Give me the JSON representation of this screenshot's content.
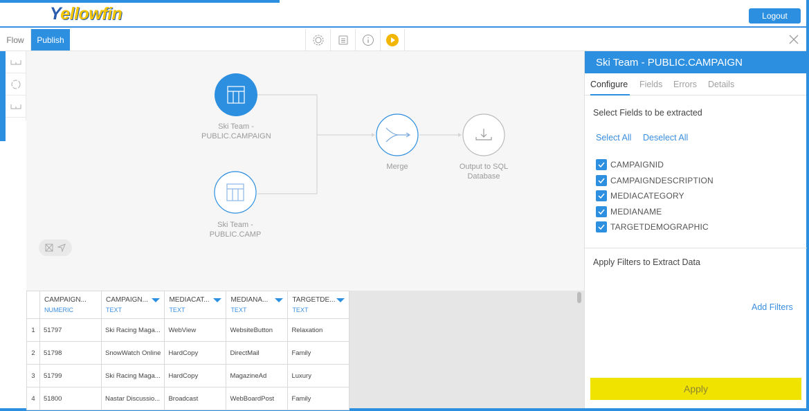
{
  "app": {
    "logo_prefix": "Y",
    "logo_rest": "ellowfin"
  },
  "header": {
    "logout_label": "Logout"
  },
  "toolbar": {
    "tabs": [
      {
        "label": "Flow"
      },
      {
        "label": "Publish"
      }
    ],
    "icons": [
      "settings-icon",
      "notes-icon",
      "info-icon",
      "play-icon"
    ]
  },
  "flow": {
    "nodes": [
      {
        "label_line1": "Ski Team -",
        "label_line2": "PUBLIC.CAMPAIGN"
      },
      {
        "label_line1": "Ski Team -",
        "label_line2": "PUBLIC.CAMP"
      },
      {
        "label_line1": "Merge",
        "label_line2": ""
      },
      {
        "label_line1": "Output to SQL",
        "label_line2": "Database"
      }
    ]
  },
  "grid": {
    "columns": [
      {
        "name": "CAMPAIGN...",
        "type": "NUMERIC"
      },
      {
        "name": "CAMPAIGN...",
        "type": "TEXT"
      },
      {
        "name": "MEDIACAT...",
        "type": "TEXT"
      },
      {
        "name": "MEDIANA...",
        "type": "TEXT"
      },
      {
        "name": "TARGETDE...",
        "type": "TEXT"
      }
    ],
    "rows": [
      {
        "num": "1",
        "cells": [
          "51797",
          "Ski Racing Maga...",
          "WebView",
          "WebsiteButton",
          "Relaxation"
        ]
      },
      {
        "num": "2",
        "cells": [
          "51798",
          "SnowWatch Online",
          "HardCopy",
          "DirectMail",
          "Family"
        ]
      },
      {
        "num": "3",
        "cells": [
          "51799",
          "Ski Racing Maga...",
          "HardCopy",
          "MagazineAd",
          "Luxury"
        ]
      },
      {
        "num": "4",
        "cells": [
          "51800",
          "Nastar Discussio...",
          "Broadcast",
          "WebBoardPost",
          "Family"
        ]
      }
    ]
  },
  "panel": {
    "title": "Ski Team - PUBLIC.CAMPAIGN",
    "tabs": [
      {
        "label": "Configure"
      },
      {
        "label": "Fields"
      },
      {
        "label": "Errors"
      },
      {
        "label": "Details"
      }
    ],
    "select_title": "Select Fields to be extracted",
    "select_all": "Select All",
    "deselect_all": "Deselect All",
    "fields": [
      {
        "label": "CAMPAIGNID",
        "checked": true
      },
      {
        "label": "CAMPAIGNDESCRIPTION",
        "checked": true
      },
      {
        "label": "MEDIACATEGORY",
        "checked": true
      },
      {
        "label": "MEDIANAME",
        "checked": true
      },
      {
        "label": "TARGETDEMOGRAPHIC",
        "checked": true
      }
    ],
    "filters_title": "Apply Filters to Extract Data",
    "add_filters": "Add Filters",
    "apply_label": "Apply"
  },
  "colors": {
    "accent": "#2d8fe0",
    "apply": "#f1e300",
    "logo_yellow": "#f3c400"
  }
}
